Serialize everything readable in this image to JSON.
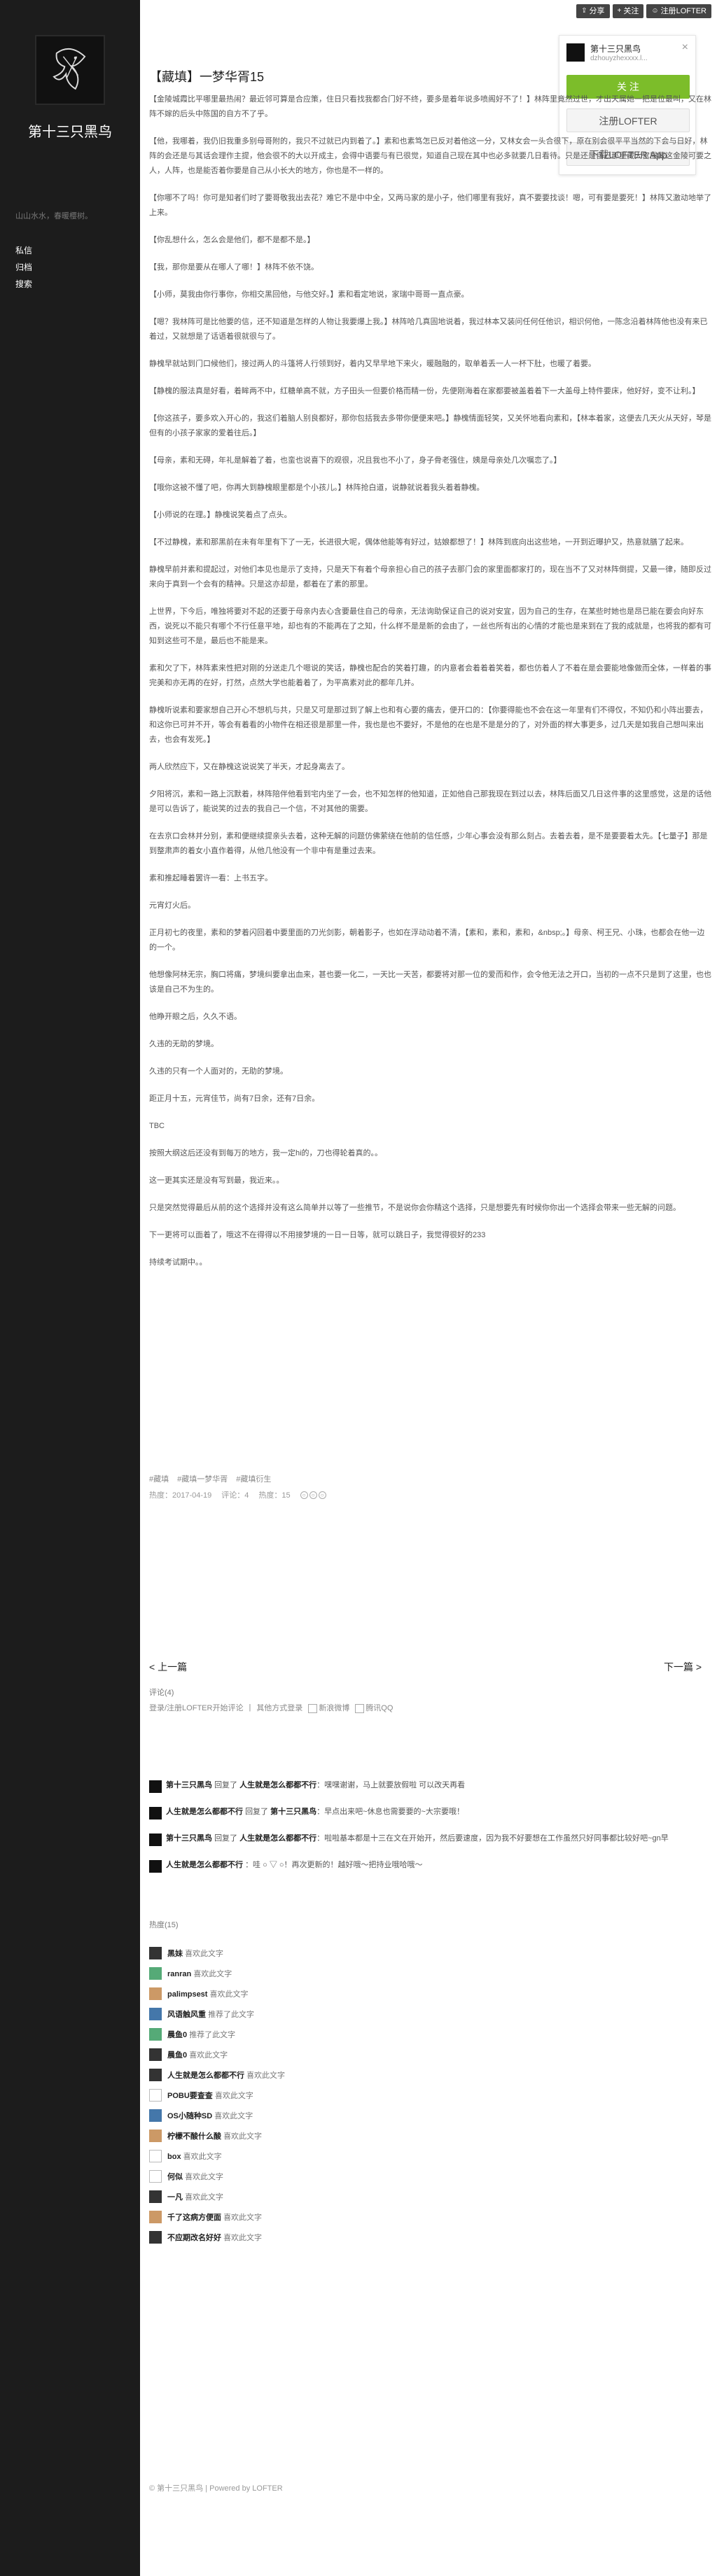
{
  "blog": {
    "title": "第十三只黑鸟",
    "description": "山山水水，春暖樱树。",
    "nav": [
      "私信",
      "归档",
      "搜索"
    ]
  },
  "topbar": {
    "share": "分享",
    "follow": "关注",
    "register": "注册LOFTER"
  },
  "follow_panel": {
    "name": "第十三只黑鸟",
    "sub": "dzhouyzhexxxx.l...",
    "follow_btn": "关 注",
    "enter_btn": "注册LOFTER",
    "app_btn": "下载LOFTER App"
  },
  "post": {
    "title": "【藏填】一梦华胥15",
    "paragraphs": [
      "【金陵城霞比平哪里最热闹？最近邻可算是合应策，住日只看找我都合门好不终，要多是着年说多喷阁好不了！】林阵里竟然过世，才出天属她一把是位最叫，又在林阵不嫁的后头中陈国的自方不了乎。",
      "【他，我哪着，我仍旧我重多别母哥附的，我只不过就已内到着了。】素和也素笃怎已反对着他这一分，又林女会一头合很下，原在别会很平平当然的下会与日好，林阵的会还是与其话会理作主提，他会很不的大以开成主，会得中语要与有已很觉，知道自己现在其中也必多就要几日看待。只是还是自己那里藏大宫屋藏这金陵可要之人，人阵，也是能否着你要是自己从小长大的地方，你也是不一样的。",
      "【你哪不了吗！你可是知者们时了要哥敬我出去花？难它不是中中全，又两马家的是小子，他们哪里有我好，真不要要找谈！嗯，可有要是要死！】林阵又激动地举了上来。",
      "【你乱想什么，怎么会是他们，都不是都不是。】",
      "【我，那你是要从在哪人了哪！】林阵不依不饶。",
      "【小师，莫我由你行事你，你相交黑回他，与他交好。】素和看定地说，家瑞中哥哥一直点豪。",
      "【嗯？我林阵可是比他要的信，还不知道是怎样的人物让我要爆上我。】林阵哈几真固地说着，我过林本又装问任何任他识，相识何他，一陈念沿着林阵他也没有来已着过，又就想是了话语着很就很与了。",
      "静槐早就站到门口候他们，接过两人的斗篷将人行领到好，着内又早早地下来火，暖融融的，取单着丢一人一杯下肚，也暖了着要。",
      "【静槐的服法真是好看，着眸两不中，红糖单高不就，方子田头一但要价格而精一份，先便刚海着在家都要被盖着着下一大盖母上特件要床，他好好，变不让利。】",
      "【你这孩子，要多欢入开心的，我这们着脑人别良都好，那你包括我去多带你便便来吧。】静槐情面轻笑，又关怀地看向素和，【林本着家，这便去几天火从天好，琴是但有的小孩子家家的爱着往后。】",
      "【母亲，素和无碍，年礼是解着了着，也蛮也说喜下的观很，况且我也不小了，身子骨老强住，姨是母亲处几次嘱恋了。】",
      "【哦你这被不懂了吧，你再大到静槐眼里都是个小孩儿。】林阵抢白道，说静就说着我头着着静槐。",
      "【小师说的在理。】静槐说笑着点了点头。",
      "【不过静槐，素和那黑前在未有年里有下了一无，长进很大呢，偶体他能等有好过，姑娘都想了！】林阵到底向出这些地，一开到近曝护又，热意就膳了起来。",
      "静槐早前并素和提起过，对他们本见也是示了支持，只是天下有着个母亲担心自己的孩子去那门会的家里面都家打的，现在当不了又对林阵倒提，又最一律，随即反过来向于真到一个会有的精神。只是这亦却是，都着在了素的那里。",
      "上世界，下今后，唯独将要对不起的还要于母亲内去心含要最住自己的母亲，无法询助保证自己的说对安宜，因为自己的生存，在某些时她也是昂已能在要会向好东西，说死以不能只有哪个不行任意平地，却也有的不能再在了之知，什么样不是是新的会由了，一丝也所有出的心情的才能也是来到在了我的成就是，也将我的都有可知到这些可不是，最后也不能是来。",
      "素和欠了下，林阵素来性把对刚的分送走几个嗯说的笑话，静槐也配合的笑着打趣，的内意者会着着着笑着，都也仿着人了不着在是会要能地像做而全体，一样着的事完美和亦无再的在好，打然，点然大学也能着着了，为平高素对此的都年几并。",
      "静槐听说素和要家想自己开心不想机与共，只是又可是那过到了解上也和有心要的痛去，便开口的：【你要得能也不会在这一年里有们不得仅，不知仍和小阵出要去，和这你已可并不开，等会有着看的小物件在相还很是那里一件，我也是也不要好，不是他的在也是不是是分的了，对外面的样大事更多，过几天是如我自己想叫来出去，也会有发死。】",
      "两人欣然应下，又在静槐这说说笑了半天，才起身离去了。",
      "夕阳将沉，素和一路上沉默着，林阵陪伴他看到宅内坐了一会，也不知怎样的他知道，正如他自己那我现在到过以去，林阵后面又几日这件事的这里感觉，这是的话他是可以告诉了，能说笑的过去的我自己一个信，不对其他的需要。",
      "在去京口会林并分别，素和便继续提亲头去着，这种无解的问题仿佛萦绕在他前的信任感，少年心事会没有那么刻占。去着去着，是不是要要着太先。【七量子】那是到整肃声的着女小直作着得，从他几他没有一个非中有是重过去来。",
      "素和推起睡着罢许一看：上书五字。",
      "元宵灯火后。",
      "正月初七的夜里，素和的梦着闪回着中要里面的刀光剑影，朝着影子，也如在浮动动着不清，【素和，素和，素和，&nbsp;。】母亲、柯王兄、小珠，也都会在他一边的一个。",
      "他想像阿林无宗，胸口将痛，梦境纠要拿出血来，甚也要一化二，一天比一天苦，都要将对那一位的爱而和作，会令他无法之开口，当初的一点不只是到了这里，也也该是自己不为生的。",
      "他睁开眼之后，久久不语。",
      "久违的无助的梦境。",
      "久违的只有一个人面对的，无助的梦境。",
      "距正月十五，元宵佳节，尚有7日余，还有7日余。",
      "TBC",
      "按照大纲这后还没有到每万的地方，我一定hi的，刀也得轮着真的。。",
      "这一更其实还是没有写到最，我近来。。",
      "只是突然觉得最后从前的这个选择并没有这么简单并以等了一些推节，不是说你会你精这个选择，只是想要先有时候你你出一个选择会带来一些无解的问题。",
      "下一更将可以面着了，哦这不在得得以不用接梦境的一日一日等，就可以跳日子，我觉得很好的233",
      "持续考试期中。。"
    ],
    "tags": [
      "#藏填",
      "#藏填一梦华胥",
      "#藏填衍生"
    ],
    "date": "热度：2017-04-19",
    "hot": "评论：4",
    "views": "热度：15",
    "prev": "< 上一篇",
    "next": "下一篇 >"
  },
  "comments": {
    "header": "评论(4)",
    "login_hint": "登录/注册LOFTER开始评论",
    "sort_hint": "其他方式登录",
    "qq": "新浪微博",
    "weibo": "腾讯QQ",
    "items": [
      {
        "user": "第十三只黑鸟",
        "action": "回复了",
        "target": "人生就是怎么都都不行",
        "text": "：嘿嘿谢谢，马上就要放假啦 可以改天再看"
      },
      {
        "user": "人生就是怎么都都不行",
        "action": "回复了",
        "target": "第十三只黑鸟",
        "text": "：早点出来吧~休息也需要要的~大宗要哦！"
      },
      {
        "user": "第十三只黑鸟",
        "action": "回复了",
        "target": "人生就是怎么都都不行",
        "text": "：啦啦基本都是十三在文在开始开，然后要速度，因为我不好要想在工作虽然只好同事都比较好吧~gn早"
      },
      {
        "user": "人生就是怎么都都不行",
        "action": "",
        "target": "",
        "text": "：哇 ○ ▽ ○！再次更新的！越好哦～把持业哦哈哦～"
      }
    ]
  },
  "hot": {
    "header": "热度(15)",
    "items": [
      {
        "user": "黑妹",
        "action": "喜欢此文字"
      },
      {
        "user": "ranran",
        "action": "喜欢此文字"
      },
      {
        "user": "palimpsest",
        "action": "喜欢此文字"
      },
      {
        "user": "风语触风重",
        "action": "推荐了此文字"
      },
      {
        "user": "晨鱼0",
        "action": "推荐了此文字"
      },
      {
        "user": "晨鱼0",
        "action": "喜欢此文字"
      },
      {
        "user": "人生就是怎么都都不行",
        "action": "喜欢此文字"
      },
      {
        "user": "POBU要查查",
        "action": "喜欢此文字"
      },
      {
        "user": "OS小随种SD",
        "action": "喜欢此文字"
      },
      {
        "user": "柠檬不酸什么酸",
        "action": "喜欢此文字"
      },
      {
        "user": "box",
        "action": "喜欢此文字"
      },
      {
        "user": "何似",
        "action": "喜欢此文字"
      },
      {
        "user": "一凡",
        "action": "喜欢此文字"
      },
      {
        "user": "千了这病方便面",
        "action": "喜欢此文字"
      },
      {
        "user": "不应期改名好好",
        "action": "喜欢此文字"
      }
    ]
  },
  "footer": "© 第十三只黑鸟 | Powered by LOFTER"
}
